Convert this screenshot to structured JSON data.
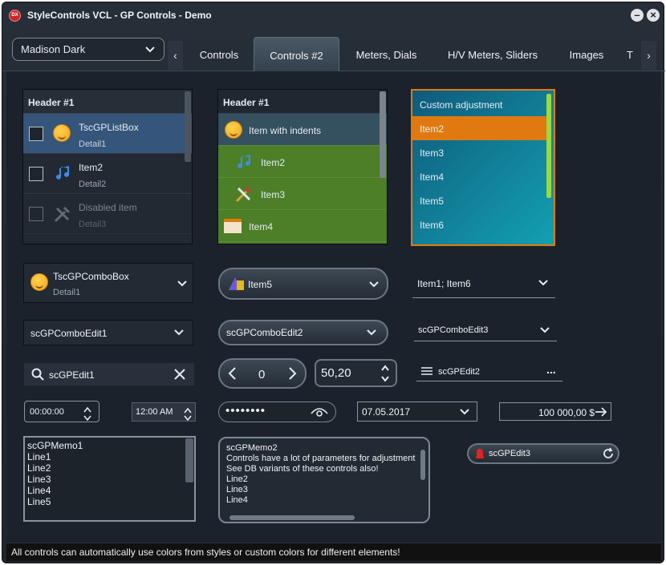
{
  "window": {
    "title": "StyleControls VCL - GP Controls - Demo",
    "icon": "dx-icon"
  },
  "style_combo": {
    "value": "Madison Dark"
  },
  "tabs": [
    "Controls",
    "Controls #2",
    "Meters, Dials",
    "H/V Meters, Sliders",
    "Images",
    "T"
  ],
  "active_tab": "Controls #2",
  "listbox1": {
    "header": "Header #1",
    "items": [
      {
        "title": "TscGPListBox",
        "detail": "Detail1",
        "icon": "smiley-icon"
      },
      {
        "title": "Item2",
        "detail": "Detail2",
        "icon": "music-note-icon"
      },
      {
        "title": "Disabled item",
        "detail": "Detail3",
        "icon": "tools-icon"
      }
    ]
  },
  "listbox2": {
    "header": "Header #1",
    "items": [
      "Item with indents",
      "Item2",
      "Item3",
      "Item4"
    ]
  },
  "listbox3": {
    "items": [
      "Custom adjustment",
      "Item2",
      "Item3",
      "Item4",
      "Item5",
      "Item6"
    ]
  },
  "combo1": {
    "title": "TscGPComboBox",
    "detail": "Detail1"
  },
  "combo2": {
    "value": "Item5"
  },
  "combo3": {
    "value": "Item1; Item6"
  },
  "comboedit1": {
    "value": "scGPComboEdit1"
  },
  "comboedit2": {
    "value": "scGPComboEdit2"
  },
  "comboedit3": {
    "value": "scGPComboEdit3"
  },
  "edit1": {
    "value": "scGPEdit1"
  },
  "spin1": {
    "value": "0"
  },
  "spin2": {
    "value": "50,20"
  },
  "edit2": {
    "value": "scGPEdit2",
    "more": "..."
  },
  "time1": {
    "value": "00:00:00"
  },
  "time2": {
    "value": "12:00 AM"
  },
  "password": {
    "value": "••••••••"
  },
  "date": {
    "value": "07.05.2017"
  },
  "currency": {
    "value": "100 000,00 $"
  },
  "memo1": {
    "lines": [
      "scGPMemo1",
      "Line1",
      "Line2",
      "Line3",
      "Line4",
      "Line5"
    ]
  },
  "memo2": {
    "lines": [
      "scGPMemo2",
      "Controls have a lot of parameters for adjustment",
      "See DB variants of these controls also!",
      "Line2",
      "Line3",
      "Line4"
    ]
  },
  "edit3": {
    "value": "scGPEdit3"
  },
  "status": {
    "text": "All controls can automatically use colors from styles or custom colors for different elements!"
  },
  "colors": {
    "accent_orange": "#e07a10",
    "teal": "#137f9a",
    "green": "#4c7f28",
    "selection": "#35557a"
  }
}
